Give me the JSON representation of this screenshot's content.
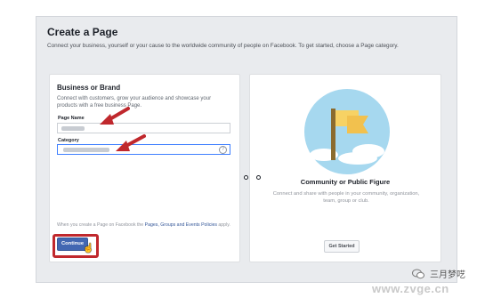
{
  "page": {
    "title": "Create a Page",
    "subtitle": "Connect your business, yourself or your cause to the worldwide community of people on Facebook. To get started, choose a Page category."
  },
  "business": {
    "title": "Business or Brand",
    "description": "Connect with customers, grow your audience and showcase your products with a free business Page.",
    "page_name_label": "Page Name",
    "category_label": "Category",
    "help_icon": "?",
    "policy_text": "When you create a Page on Facebook the ",
    "policy_link": "Pages, Groups and Events Policies",
    "policy_tail": " apply.",
    "continue_label": "Continue"
  },
  "community": {
    "title": "Community or Public Figure",
    "description": "Connect and share with people in your community, organization, team, group or club.",
    "get_started_label": "Get Started"
  },
  "watermark": {
    "name": "三月梦呓",
    "url": "www.zvge.cn"
  },
  "colors": {
    "annotation_red": "#c0282d",
    "facebook_blue": "#4267b2",
    "illustration_sky": "#a6d8ef",
    "flag_yellow": "#f7d264"
  },
  "icons": [
    "help-icon",
    "flag-icon",
    "cursor-icon",
    "wechat-icon"
  ]
}
